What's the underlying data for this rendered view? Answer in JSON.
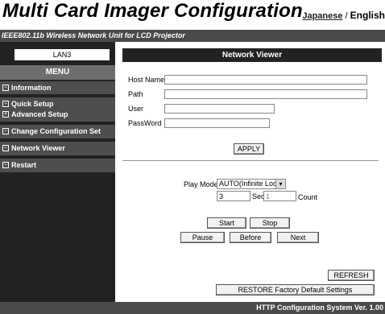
{
  "header": {
    "title": "Multi Card Imager Configuration",
    "lang_ja": "Japanese",
    "lang_sep": " / ",
    "lang_en": "English",
    "subtitle": "IEEE802.11b Wireless Network Unit for LCD Projector"
  },
  "sidebar": {
    "lan": "LAN3",
    "menu_label": "MENU",
    "items": [
      {
        "label": "Information",
        "icon": "minus-box-icon"
      },
      {
        "label": "Quick Setup",
        "icon": "minus-box-icon"
      },
      {
        "label": "Advanced Setup",
        "icon": "plus-box-icon"
      },
      {
        "label": "Change Configuration Set",
        "icon": "minus-box-icon"
      },
      {
        "label": "Network Viewer",
        "icon": "minus-box-icon"
      },
      {
        "label": "Restart",
        "icon": "minus-box-icon"
      }
    ]
  },
  "main": {
    "section_title": "Network Viewer",
    "fields": {
      "host_name_label": "Host Name",
      "host_name_value": "",
      "path_label": "Path",
      "path_value": "",
      "user_label": "User",
      "user_value": "",
      "password_label": "PassWord",
      "password_value": ""
    },
    "apply_label": "APPLY",
    "play_mode_label": "Play Mode",
    "play_mode_value": "AUTO(Infinite Loop)",
    "sec_value": "3",
    "sec_label": "Sec",
    "count_value": "1",
    "count_label": "Count",
    "start_label": "Start",
    "stop_label": "Stop",
    "pause_label": "Pause",
    "before_label": "Before",
    "next_label": "Next",
    "refresh_label": "REFRESH",
    "restore_label": "RESTORE Factory Default Settings"
  },
  "footer": {
    "text": "HTTP Configuration System Ver. 1.00"
  }
}
